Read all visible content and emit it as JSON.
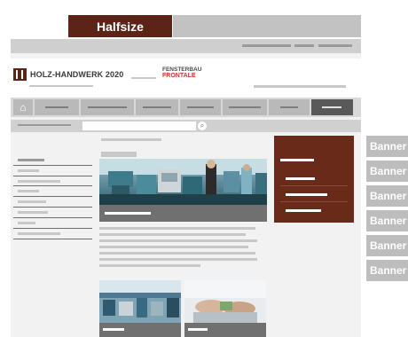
{
  "ad": {
    "halfsize_label": "Halfsize"
  },
  "header": {
    "logo_text": "HOLZ-HANDWERK 2020",
    "partner_logo_line1": "FENSTERBAU",
    "partner_logo_line2": "FRONTALE"
  },
  "banners": [
    "Banner",
    "Banner",
    "Banner",
    "Banner",
    "Banner",
    "Banner"
  ],
  "icons": {
    "home": "home-icon",
    "search": "search-icon"
  },
  "colors": {
    "brand": "#5b2416",
    "promo": "#6a2a1a",
    "banner": "#bdbdbd",
    "nav_active": "#595959"
  }
}
